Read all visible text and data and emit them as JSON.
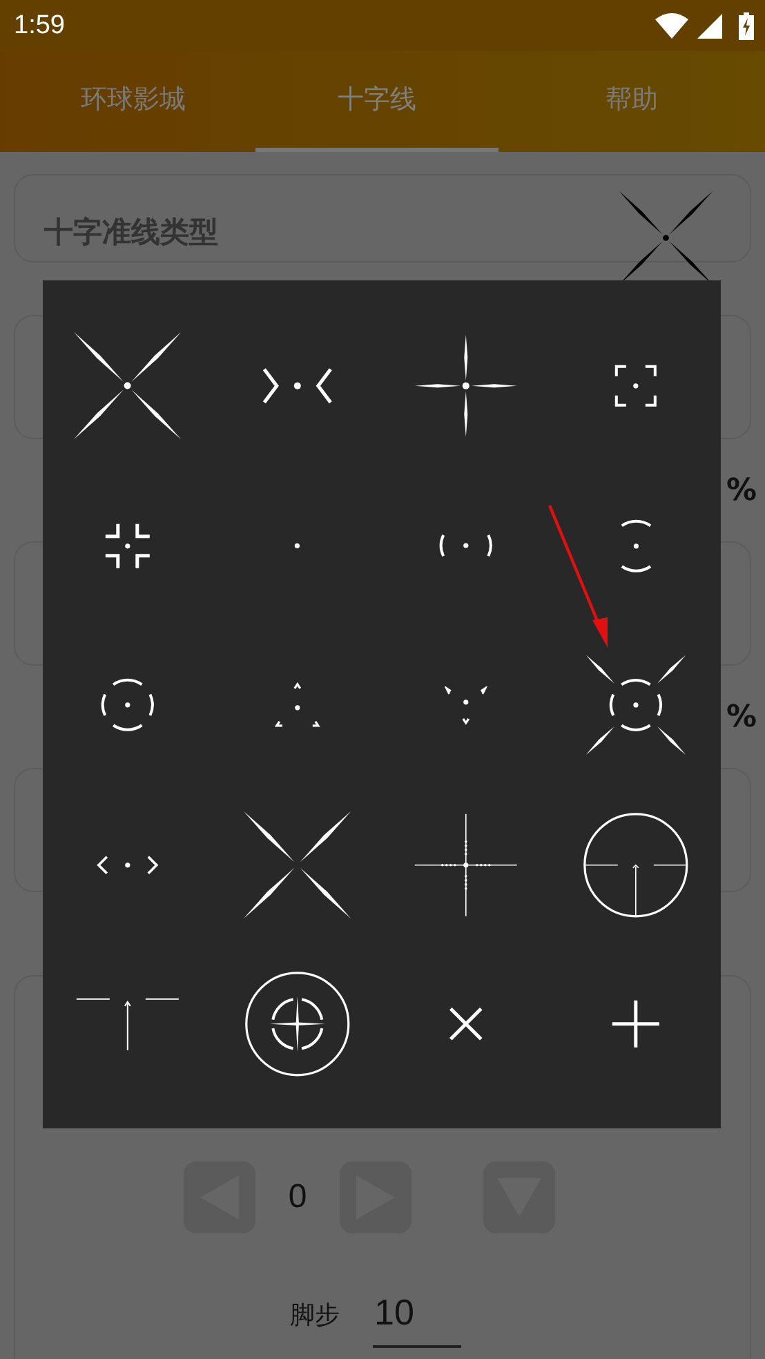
{
  "status_bar": {
    "time": "1:59"
  },
  "tabs": [
    {
      "label": "环球影城",
      "selected": false
    },
    {
      "label": "十字线",
      "selected": true
    },
    {
      "label": "帮助",
      "selected": false
    }
  ],
  "crosshair_type": {
    "label": "十字准线类型",
    "current": {
      "kind": "xstar"
    }
  },
  "percent_labels": [
    "%",
    "%"
  ],
  "offset_controls": {
    "value": "0"
  },
  "step": {
    "label": "脚步",
    "value": "10"
  },
  "reticle_dialog": {
    "options": [
      {
        "kind": "xstar"
      },
      {
        "kind": "chevrons"
      },
      {
        "kind": "fourpoint"
      },
      {
        "kind": "brackets"
      },
      {
        "kind": "corners"
      },
      {
        "kind": "dot"
      },
      {
        "kind": "parens"
      },
      {
        "kind": "arcs"
      },
      {
        "kind": "circle"
      },
      {
        "kind": "triangle"
      },
      {
        "kind": "invtriangle"
      },
      {
        "kind": "circlex"
      },
      {
        "kind": "angles"
      },
      {
        "kind": "bigx"
      },
      {
        "kind": "mil"
      },
      {
        "kind": "scope"
      },
      {
        "kind": "tpost"
      },
      {
        "kind": "target"
      },
      {
        "kind": "smallx"
      },
      {
        "kind": "plus"
      }
    ]
  }
}
